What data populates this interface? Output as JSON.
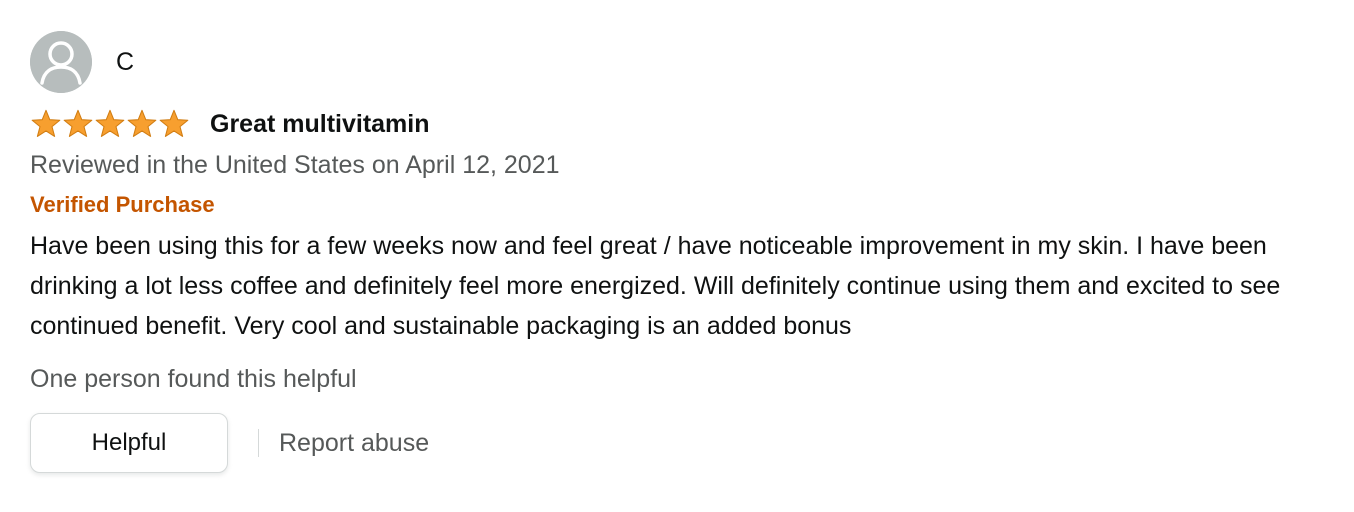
{
  "reviewer": {
    "name": "C",
    "avatar_icon": "user-silhouette-icon"
  },
  "review": {
    "rating": 5,
    "rating_max": 5,
    "title": "Great multivitamin",
    "date": "Reviewed in the United States on April 12, 2021",
    "verified_label": "Verified Purchase",
    "body": "Have been using this for a few weeks now and feel great / have noticeable improvement in my skin. I have been drinking a lot less coffee and definitely feel more energized. Will definitely continue using them and excited to see continued benefit. Very cool and sustainable packaging is an added bonus",
    "helpful_count_text": "One person found this helpful"
  },
  "actions": {
    "helpful_label": "Helpful",
    "report_label": "Report abuse"
  },
  "colors": {
    "star": "#F79F2F",
    "verified": "#C45500",
    "text": "#0F1111",
    "secondary_text": "#565959",
    "avatar_bg": "#B7BDBD"
  }
}
